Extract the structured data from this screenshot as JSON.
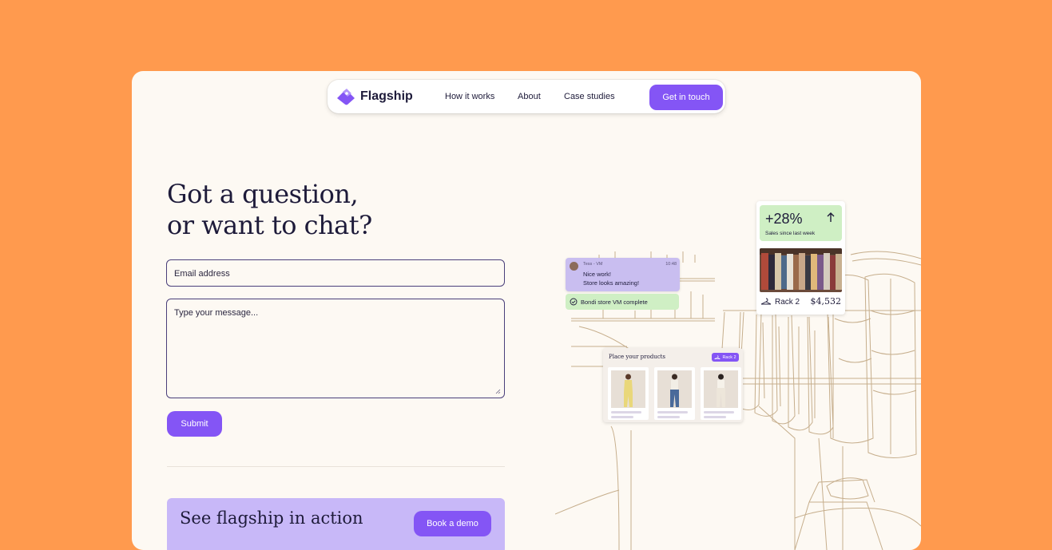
{
  "nav": {
    "brand": "Flagship",
    "links": [
      "How it works",
      "About",
      "Case studies"
    ],
    "cta": "Get in touch"
  },
  "form": {
    "heading_line1": "Got a question,",
    "heading_line2": "or want to chat?",
    "email_placeholder": "Email address",
    "message_placeholder": "Type your message...",
    "submit": "Submit"
  },
  "demo": {
    "title": "See flagship in action",
    "button": "Book a demo"
  },
  "illustration": {
    "chat": {
      "name": "Tess - VM",
      "time": "10:48",
      "line1": "Nice work!",
      "line2": "Store looks amazing!"
    },
    "status": "Bondi store VM complete",
    "stat": {
      "value": "+28%",
      "caption": "Sales since last week",
      "rack": "Rack 2",
      "amount": "$4,532"
    },
    "place": {
      "title": "Place your products",
      "badge": "Rack 2"
    }
  },
  "colors": {
    "background": "#FF9A4E",
    "card": "#FDF9F3",
    "accent": "#8455F5",
    "ink": "#1E1B3A",
    "chat": "#C9BEF0",
    "success": "#CFEFC4",
    "demo_panel": "#C8B8F8"
  }
}
